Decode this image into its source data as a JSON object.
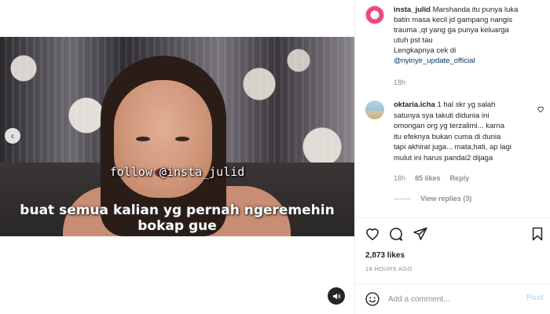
{
  "video": {
    "overlay_follow": "follow @insta_julid",
    "overlay_caption_line1": "buat semua kalian yg pernah ngeremehin",
    "overlay_caption_line2": "bokap gue"
  },
  "caption": {
    "username": "insta_julid",
    "text_line1": " Marshanda itu punya luka",
    "text_line2": "batin masa kecil jd gampang nangis",
    "text_line3": "trauma ,qt yang ga punya keluarga",
    "text_line4": "utuh pst tau",
    "text_line5": "Lengkapnya cek di",
    "mention": "@nyinyir_update_official",
    "time": "18h"
  },
  "comment": {
    "username": "oktaria.icha",
    "text_line1": " 1 hal skr yg salah",
    "text_line2": "satunya sya takuti didunia ini",
    "text_line3": "omongan org yg terzalimi... karna",
    "text_line4": "itu efeknya bukan cuma di dunia",
    "text_line5": "tapi akhirat juga... mata,hati, ap lagi",
    "text_line6": "mulut ini harus pandai2 dijaga",
    "time": "18h",
    "likes": "85 likes",
    "reply": "Reply",
    "view_replies": "View replies (3)"
  },
  "post": {
    "likes": "2,873 likes",
    "ago": "18 HOURS AGO"
  },
  "comment_input": {
    "placeholder": "Add a comment...",
    "post_label": "Post"
  },
  "colors": {
    "link": "#00376b",
    "muted": "#8e8e8e",
    "post_disabled": "#b2dffc"
  }
}
